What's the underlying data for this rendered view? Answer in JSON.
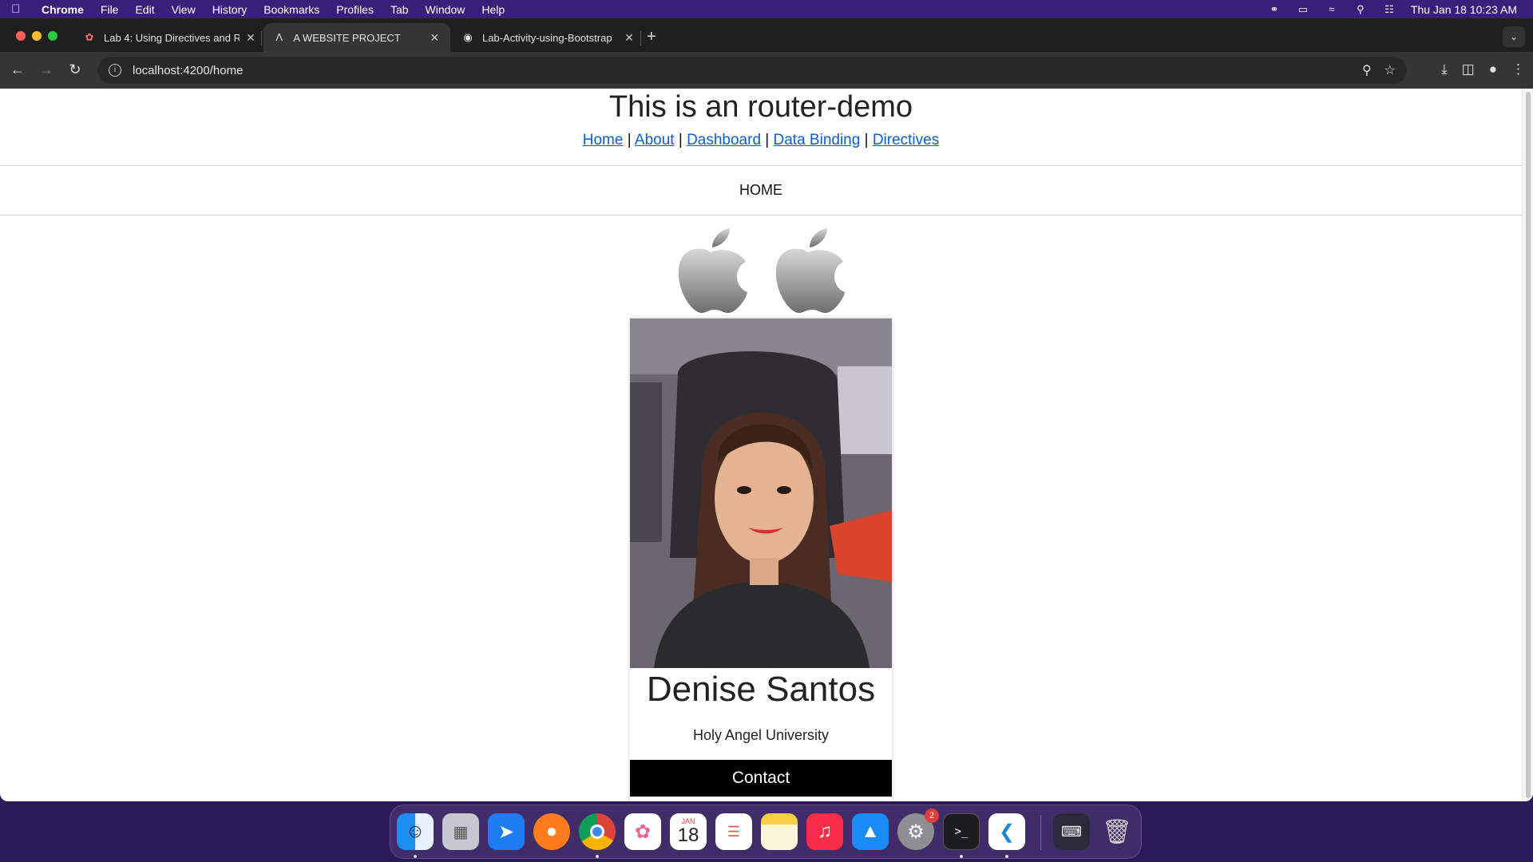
{
  "menubar": {
    "app_name": "Chrome",
    "items": [
      "File",
      "Edit",
      "View",
      "History",
      "Bookmarks",
      "Profiles",
      "Tab",
      "Window",
      "Help"
    ],
    "clock": "Thu Jan 18  10:23 AM"
  },
  "tabs": [
    {
      "label": "Lab 4: Using Directives and R",
      "icon": "lab-favicon",
      "active": false
    },
    {
      "label": "A WEBSITE PROJECT",
      "icon": "angular-favicon",
      "active": true
    },
    {
      "label": "Lab-Activity-using-Bootstrap",
      "icon": "github-favicon",
      "active": false
    }
  ],
  "address_bar": {
    "url": "localhost:4200/home"
  },
  "page": {
    "title": "This is an router-demo",
    "nav": [
      "Home",
      "About",
      "Dashboard",
      "Data Binding",
      "Directives"
    ],
    "nav_separator": "|",
    "section_heading": "HOME",
    "logos": [
      "apple-logo",
      "apple-logo"
    ],
    "card": {
      "name": "Denise Santos",
      "school": "Holy Angel University",
      "button_label": "Contact"
    }
  },
  "dock": {
    "apps": [
      "Finder",
      "Launchpad",
      "Safari",
      "Firefox",
      "Chrome",
      "Photos",
      "Calendar",
      "Reminders",
      "Notes",
      "Music",
      "App Store",
      "System Settings",
      "Terminal",
      "VS Code",
      "Keyboard Viewer",
      "Trash"
    ],
    "calendar_month": "JAN",
    "calendar_day": "18",
    "settings_badge": "2"
  },
  "colors": {
    "link": "#0d5ed6",
    "contact_button": "#000000",
    "menubar": "#3a1f7a"
  }
}
